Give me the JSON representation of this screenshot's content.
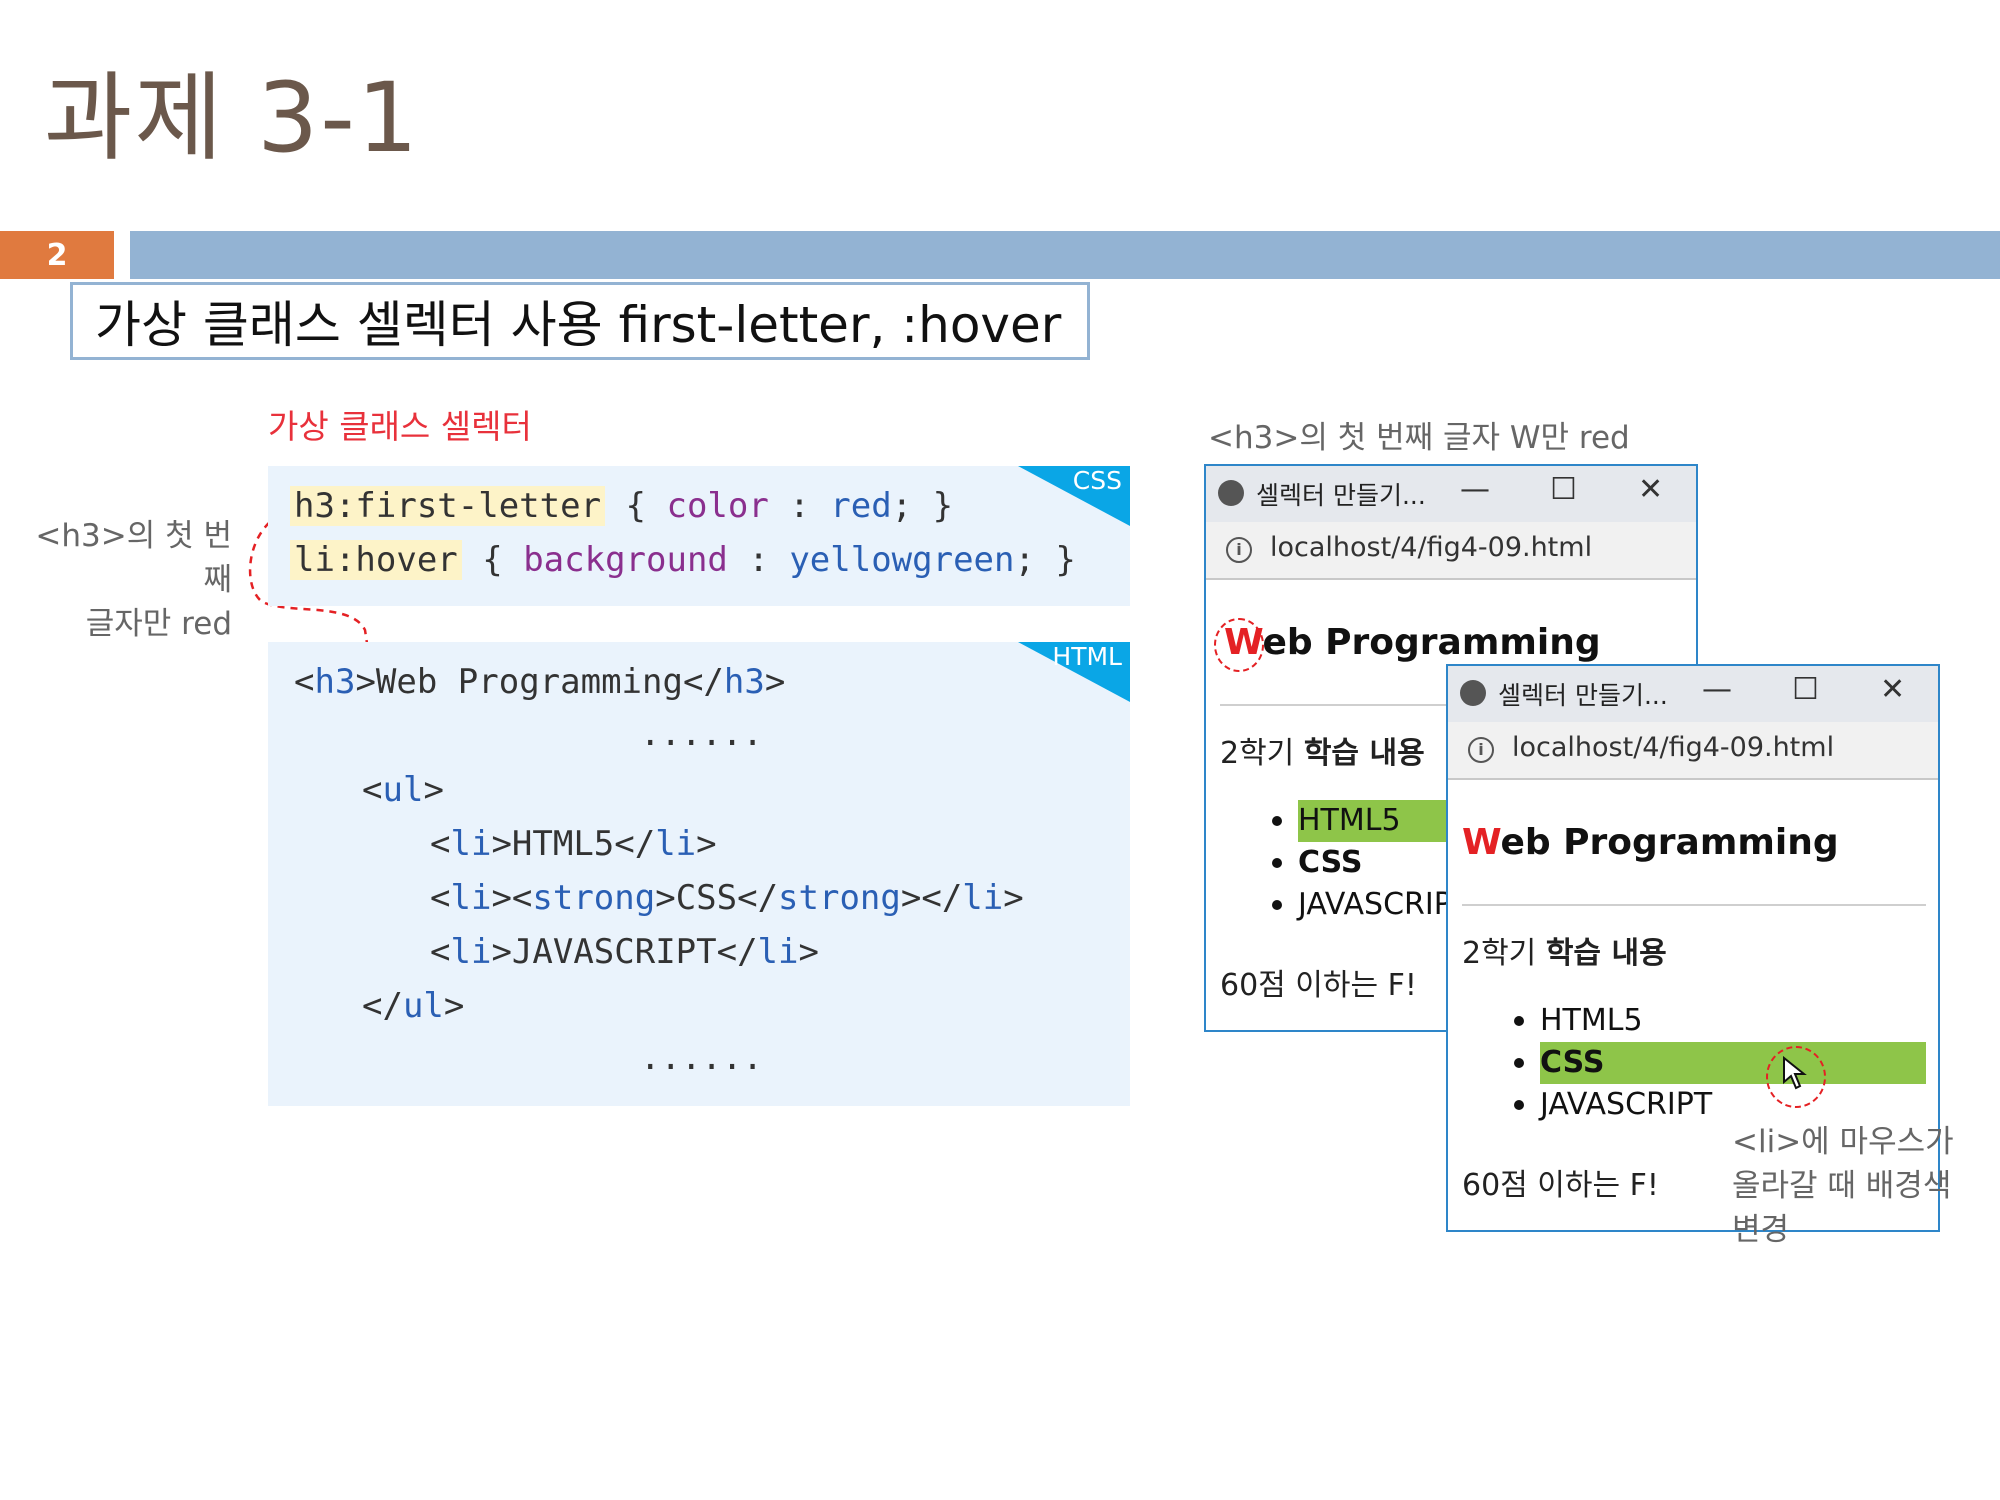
{
  "slide": {
    "title": "과제 3-1",
    "page_number": "2",
    "subtitle": "가상 클래스 셀렉터 사용 first-letter, :hover",
    "accent_bar_color": "#93b3d3",
    "badge_color": "#e07a3f"
  },
  "code": {
    "pseudo_label": "가상 클래스 셀렉터",
    "side_note_line1": "<h3>의 첫 번째",
    "side_note_line2": "글자만 red",
    "css_tag": "CSS",
    "html_tag": "HTML",
    "css": {
      "line1_selector": "h3:first-letter",
      "line1_open": " { ",
      "line1_prop": "color",
      "line1_colon": " : ",
      "line1_value": "red",
      "line1_close": "; }",
      "line2_selector": "li:hover",
      "line2_open": " { ",
      "line2_prop": "background",
      "line2_colon": " : ",
      "line2_value": "yellowgreen",
      "line2_close": "; }"
    },
    "html": {
      "l1_a": "<",
      "l1_tag": "h3",
      "l1_b": ">Web Programming</",
      "l1_tag2": "h3",
      "l1_c": ">",
      "dots1": "......",
      "l2_a": "<",
      "l2_tag": "ul",
      "l2_b": ">",
      "l3_a": "<",
      "l3_tag": "li",
      "l3_b": ">HTML5</",
      "l3_tag2": "li",
      "l3_c": ">",
      "l4_a": "<",
      "l4_tag": "li",
      "l4_b": "><",
      "l4_tag2": "strong",
      "l4_c": ">CSS</",
      "l4_tag3": "strong",
      "l4_d": "></",
      "l4_tag4": "li",
      "l4_e": ">",
      "l5_a": "<",
      "l5_tag": "li",
      "l5_b": ">JAVASCRIPT</",
      "l5_tag2": "li",
      "l5_c": ">",
      "l6_a": "</",
      "l6_tag": "ul",
      "l6_b": ">",
      "dots2": "......"
    }
  },
  "browser_caption": "<h3>의 첫 번째 글자 W만 red",
  "browser1": {
    "title": "셀렉터 만들기...",
    "minimize": "—",
    "maximize": "☐",
    "close": "✕",
    "url": "localhost/4/fig4-09.html",
    "h3_first": "W",
    "h3_rest": "eb Programming",
    "para_a": "2학기 ",
    "para_b": "학습 내용",
    "items": [
      "HTML5",
      "CSS",
      "JAVASCRIPT"
    ],
    "footer": "60점 이하는 F!"
  },
  "browser2": {
    "title": "셀렉터 만들기...",
    "minimize": "—",
    "maximize": "☐",
    "close": "✕",
    "url": "localhost/4/fig4-09.html",
    "h3_first": "W",
    "h3_rest": "eb Programming",
    "para_a": "2학기 ",
    "para_b": "학습 내용",
    "items": [
      "HTML5",
      "CSS",
      "JAVASCRIPT"
    ],
    "footer": "60점 이하는 F!"
  },
  "hover_note": {
    "line1": "<li>에 마우스가",
    "line2": "올라갈 때 배경색",
    "line3": "변경"
  },
  "colors": {
    "red": "#e42124",
    "yellowgreen": "#8ec549",
    "window_border": "#2e86c9",
    "code_bg": "#eaf3fc",
    "tag_corner": "#0aa6e6"
  }
}
